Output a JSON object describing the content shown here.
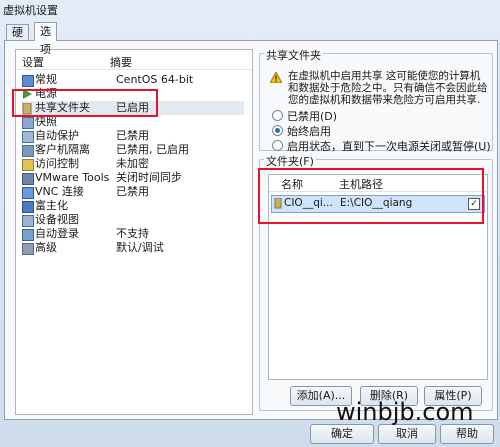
{
  "window": {
    "title": "虚拟机设置"
  },
  "tabs": [
    {
      "label": "硬件"
    },
    {
      "label": "选项"
    }
  ],
  "settings_list": {
    "col_setting": "设置",
    "col_summary": "摘要",
    "items": [
      {
        "name": "常规",
        "summary": "CentOS 64-bit"
      },
      {
        "name": "电源",
        "summary": ""
      },
      {
        "name": "共享文件夹",
        "summary": "已启用"
      },
      {
        "name": "快照",
        "summary": ""
      },
      {
        "name": "自动保护",
        "summary": "已禁用"
      },
      {
        "name": "客户机隔离",
        "summary": "已禁用, 已启用"
      },
      {
        "name": "访问控制",
        "summary": "未加密"
      },
      {
        "name": "VMware Tools",
        "summary": "关闭时间同步"
      },
      {
        "name": "VNC 连接",
        "summary": "已禁用"
      },
      {
        "name": "富主化",
        "summary": ""
      },
      {
        "name": "设备视图",
        "summary": ""
      },
      {
        "name": "自动登录",
        "summary": "不支持"
      },
      {
        "name": "高级",
        "summary": "默认/调试"
      }
    ]
  },
  "shared_folders": {
    "group_title": "共享文件夹",
    "warning_text": "在虚拟机中启用共享 这可能使您的计算机和数据处于危险之中。只有确信不会因此给您的虚拟机和数据带来危险方可启用共享.",
    "options": [
      {
        "label": "已禁用(D)",
        "selected": false
      },
      {
        "label": "始终启用",
        "selected": true
      },
      {
        "label": "启用状态，直到下一次电源关闭或暂停(U)",
        "selected": false
      }
    ]
  },
  "folders": {
    "group_title": "文件夹(F)",
    "col_name": "名称",
    "col_path": "主机路径",
    "rows": [
      {
        "name": "CIO__qi...",
        "path": "E:\\CIO__qiang",
        "checked": true
      }
    ],
    "add_button": "添加(A)...",
    "remove_button": "删除(R)",
    "properties_button": "属性(P)"
  },
  "footer": {
    "ok_button": "确定",
    "cancel_button": "取消",
    "help_button": "帮助"
  },
  "watermark": "winbjb.com",
  "colors": {
    "highlight_box": "#e8132a",
    "selection": "#cfe3fb"
  }
}
